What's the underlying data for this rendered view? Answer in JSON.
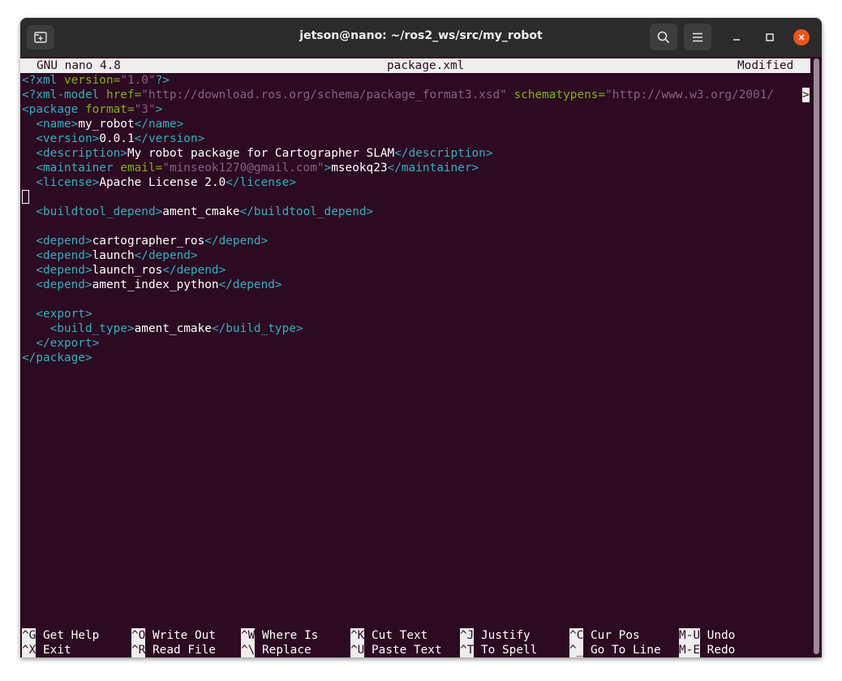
{
  "window": {
    "title": "jetson@nano: ~/ros2_ws/src/my_robot"
  },
  "icons": {
    "new_tab": "new-tab-icon",
    "search": "search-icon",
    "menu": "hamburger-menu-icon",
    "minimize": "minimize-icon",
    "maximize": "maximize-icon",
    "close": "close-icon"
  },
  "colors": {
    "terminal_bg": "#2c0a22",
    "titlebar_bg": "#2b2b2b",
    "tag": "#34b0bd",
    "attr": "#7fb20f",
    "string": "#8b5f85",
    "close_button": "#e95420"
  },
  "nano": {
    "version_label": "GNU nano 4.8",
    "filename": "package.xml",
    "status": "Modified",
    "overflow_marker": ">"
  },
  "code": {
    "l1": {
      "a": "<?xml ",
      "b": "version=",
      "c": "\"1.0\"",
      "d": "?>"
    },
    "l2": {
      "a": "<?xml-model ",
      "b": "href=",
      "c": "\"http://download.ros.org/schema/package_format3.xsd\"",
      "d": " schematypens=",
      "e": "\"http://www.w3.org/2001/"
    },
    "l3": {
      "a": "<package ",
      "b": "format=",
      "c": "\"3\"",
      "d": ">"
    },
    "l4": {
      "a": "  <name>",
      "b": "my_robot",
      "c": "</name>"
    },
    "l5": {
      "a": "  <version>",
      "b": "0.0.1",
      "c": "</version>"
    },
    "l6": {
      "a": "  <description>",
      "b": "My robot package for Cartographer SLAM",
      "c": "</description>"
    },
    "l7": {
      "a": "  <maintainer ",
      "b": "email=",
      "c": "\"minseok1270@gmail.com\"",
      "d": ">",
      "e": "mseokq23",
      "f": "</maintainer>"
    },
    "l8": {
      "a": "  <license>",
      "b": "Apache License 2.0",
      "c": "</license>"
    },
    "l10": {
      "a": "  <buildtool_depend>",
      "b": "ament_cmake",
      "c": "</buildtool_depend>"
    },
    "l12": {
      "a": "  <depend>",
      "b": "cartographer_ros",
      "c": "</depend>"
    },
    "l13": {
      "a": "  <depend>",
      "b": "launch",
      "c": "</depend>"
    },
    "l14": {
      "a": "  <depend>",
      "b": "launch_ros",
      "c": "</depend>"
    },
    "l15": {
      "a": "  <depend>",
      "b": "ament_index_python",
      "c": "</depend>"
    },
    "l17": {
      "a": "  <export>"
    },
    "l18": {
      "a": "    <build_type>",
      "b": "ament_cmake",
      "c": "</build_type>"
    },
    "l19": {
      "a": "  </export>"
    },
    "l20": {
      "a": "</package>"
    }
  },
  "shortcuts": {
    "row1": [
      {
        "key": "^G",
        "label": "Get Help"
      },
      {
        "key": "^O",
        "label": "Write Out"
      },
      {
        "key": "^W",
        "label": "Where Is"
      },
      {
        "key": "^K",
        "label": "Cut Text"
      },
      {
        "key": "^J",
        "label": "Justify"
      },
      {
        "key": "^C",
        "label": "Cur Pos"
      },
      {
        "key": "M-U",
        "label": "Undo"
      }
    ],
    "row2": [
      {
        "key": "^X",
        "label": "Exit"
      },
      {
        "key": "^R",
        "label": "Read File"
      },
      {
        "key": "^\\",
        "label": "Replace"
      },
      {
        "key": "^U",
        "label": "Paste Text"
      },
      {
        "key": "^T",
        "label": "To Spell"
      },
      {
        "key": "^_",
        "label": "Go To Line"
      },
      {
        "key": "M-E",
        "label": "Redo"
      }
    ]
  }
}
